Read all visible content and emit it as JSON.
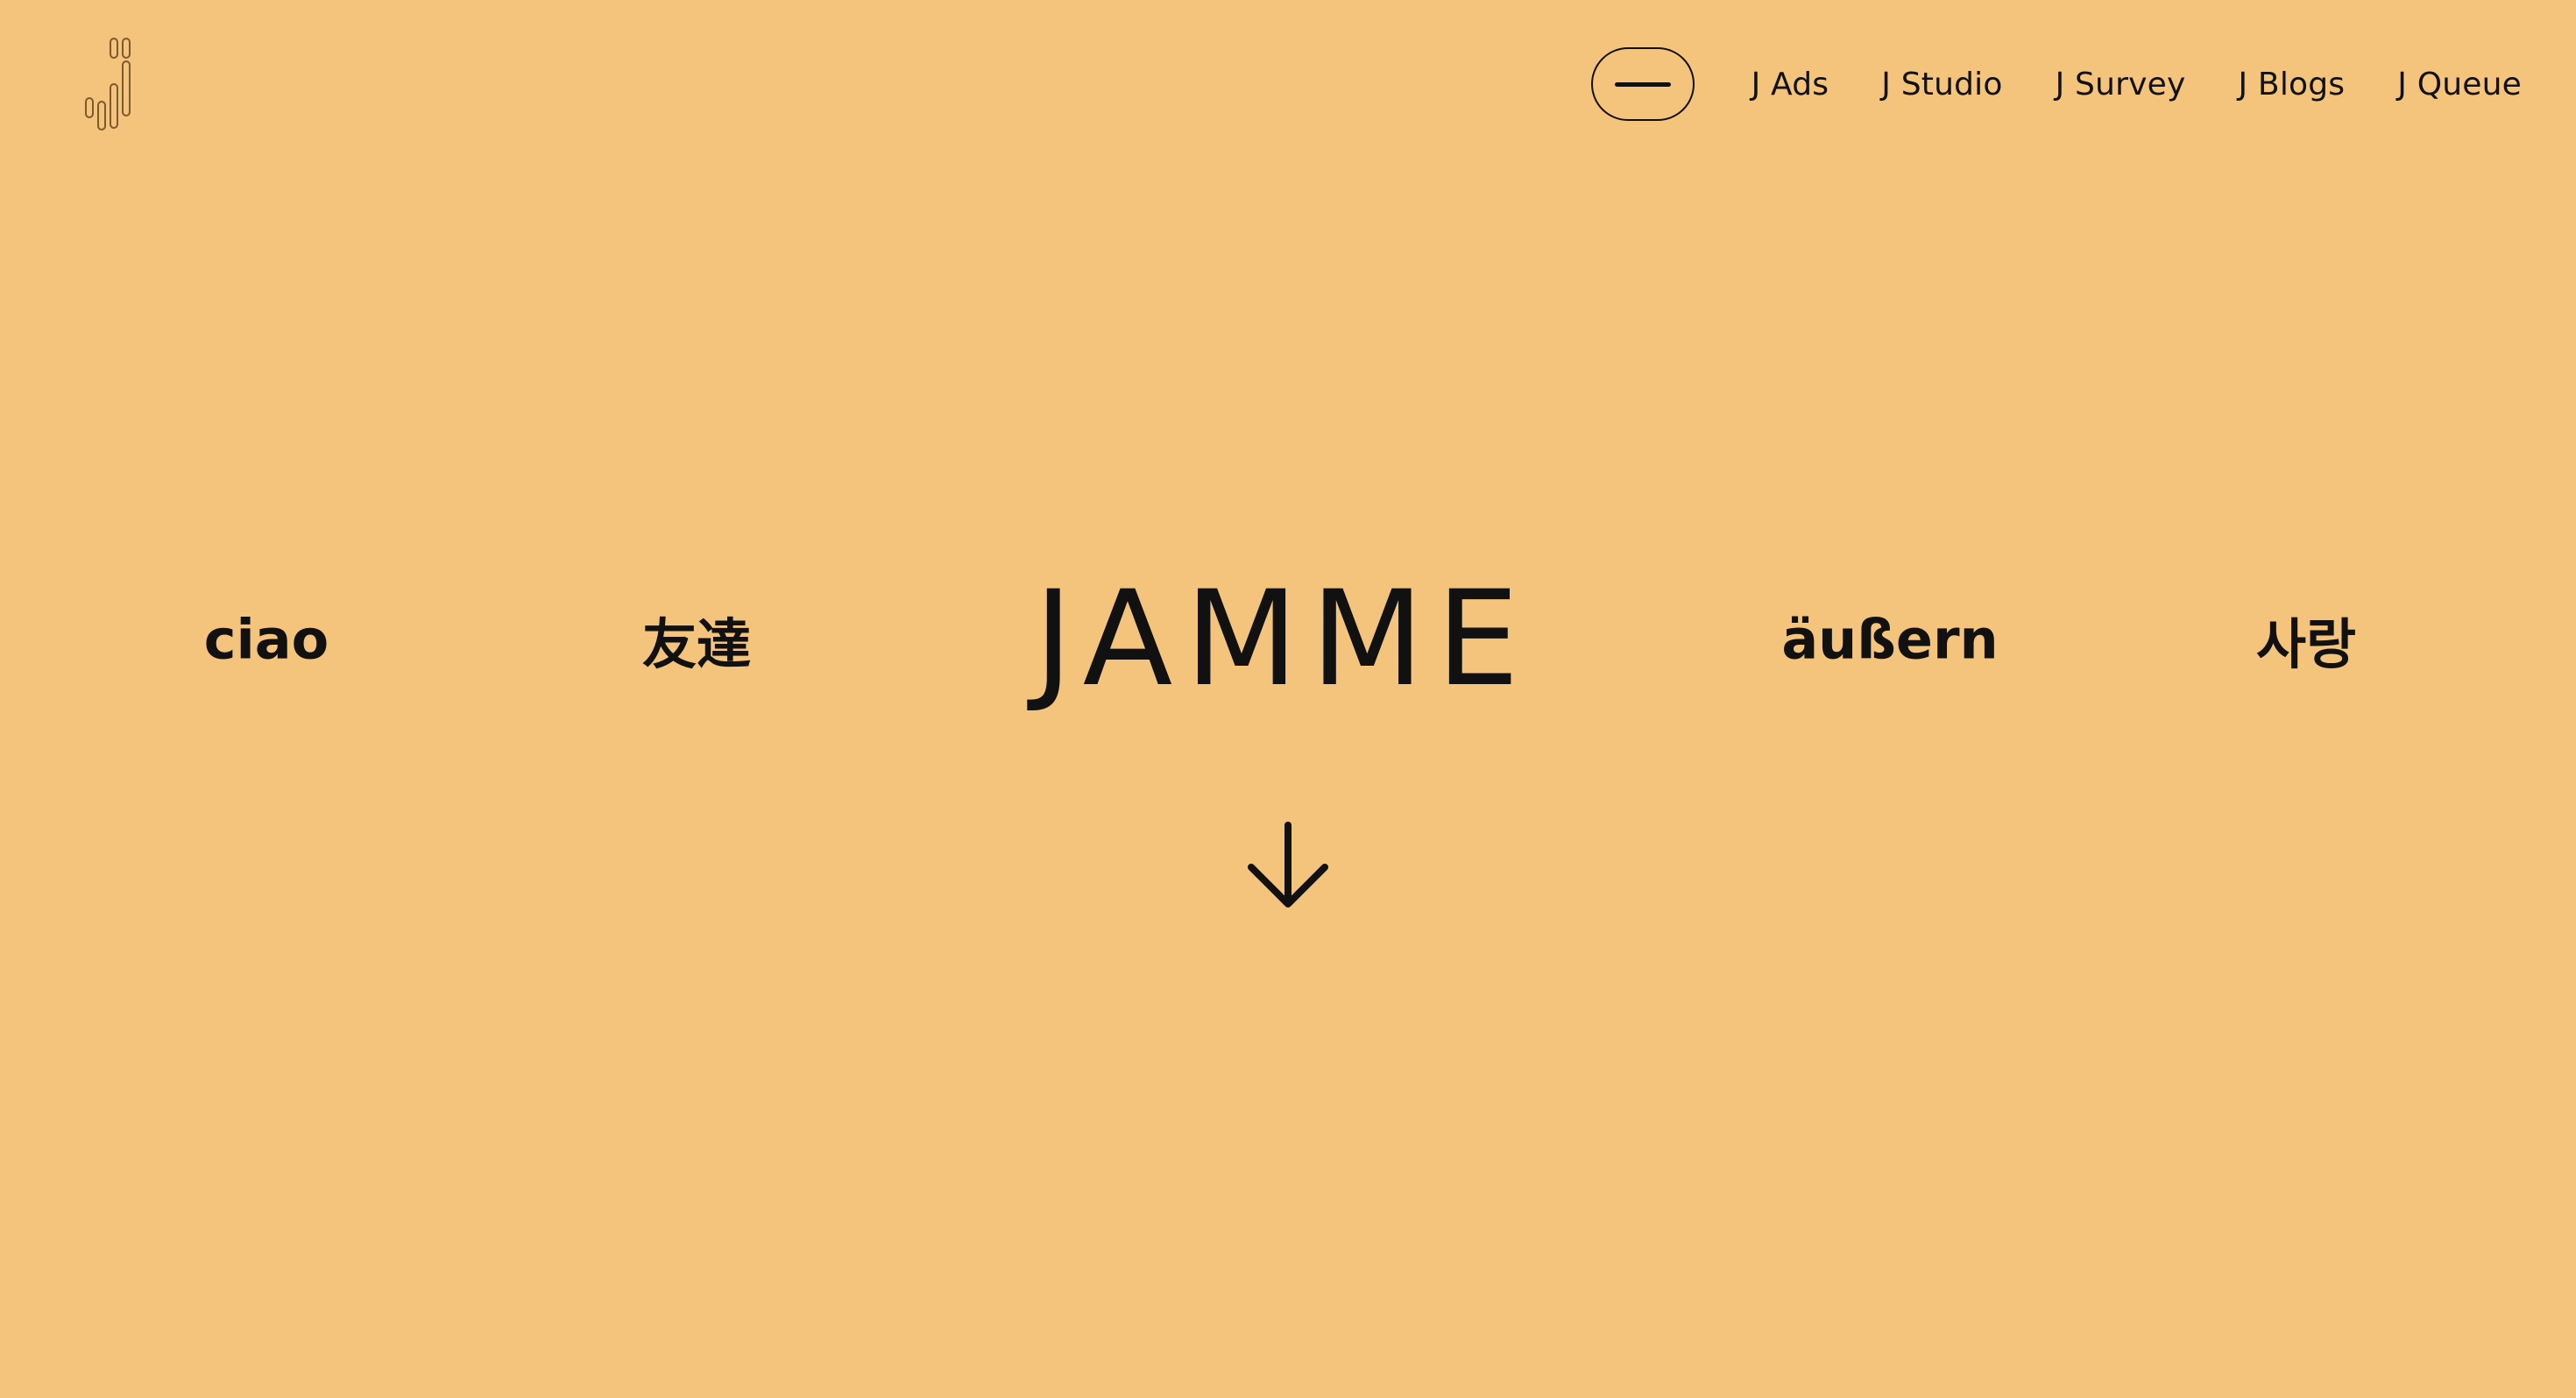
{
  "brand": {
    "logo_icon": "equalizer-bars-logo-icon",
    "accent_color": "#F4C47C",
    "text_color": "#111111"
  },
  "header": {
    "menu_icon": "hamburger-line-icon",
    "nav": [
      {
        "label": "J Ads"
      },
      {
        "label": "J Studio"
      },
      {
        "label": "J Survey"
      },
      {
        "label": "J Blogs"
      },
      {
        "label": "J Queue"
      }
    ]
  },
  "hero": {
    "words": [
      "ciao",
      "友達",
      "JAMME",
      "äußern",
      "사랑"
    ],
    "scroll_icon": "arrow-down-icon"
  }
}
